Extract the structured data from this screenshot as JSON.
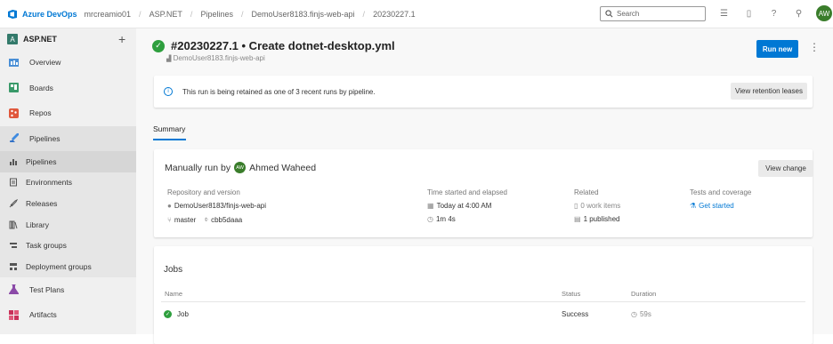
{
  "topbar": {
    "brand": "Azure DevOps",
    "breadcrumbs": [
      "mrcreamio01",
      "ASP.NET",
      "Pipelines",
      "DemoUser8183.finjs-web-api",
      "20230227.1"
    ],
    "search_placeholder": "Search",
    "avatar_initials": "AW"
  },
  "sidebar": {
    "project_initial": "A",
    "project_name": "ASP.NET",
    "main_items": [
      {
        "label": "Overview",
        "icon": "overview-icon"
      },
      {
        "label": "Boards",
        "icon": "boards-icon"
      },
      {
        "label": "Repos",
        "icon": "repos-icon"
      },
      {
        "label": "Pipelines",
        "icon": "pipelines-icon"
      }
    ],
    "sub_items": [
      {
        "label": "Pipelines",
        "icon": "pipelines-sub-icon"
      },
      {
        "label": "Environments",
        "icon": "environments-icon"
      },
      {
        "label": "Releases",
        "icon": "releases-icon"
      },
      {
        "label": "Library",
        "icon": "library-icon"
      },
      {
        "label": "Task groups",
        "icon": "task-groups-icon"
      },
      {
        "label": "Deployment groups",
        "icon": "deployment-groups-icon"
      }
    ],
    "bottom_items": [
      {
        "label": "Test Plans",
        "icon": "test-plans-icon"
      },
      {
        "label": "Artifacts",
        "icon": "artifacts-icon"
      }
    ]
  },
  "run": {
    "title": "#20230227.1 • Create dotnet-desktop.yml",
    "repo": "DemoUser8183.finjs-web-api",
    "run_new_label": "Run new"
  },
  "banner": {
    "text": "This run is being retained as one of 3 recent runs by pipeline.",
    "button": "View retention leases"
  },
  "tabs": {
    "summary": "Summary"
  },
  "summary": {
    "manually_run_by": "Manually run by",
    "user_initials": "AW",
    "user_name": "Ahmed Waheed",
    "view_change": "View change",
    "repo_header": "Repository and version",
    "repo_value": "DemoUser8183/finjs-web-api",
    "branch": "master",
    "commit": "cbb5daaa",
    "time_header": "Time started and elapsed",
    "time_started": "Today at 4:00 AM",
    "elapsed": "1m 4s",
    "related_header": "Related",
    "work_items": "0 work items",
    "published": "1 published",
    "tests_header": "Tests and coverage",
    "get_started": "Get started"
  },
  "jobs": {
    "title": "Jobs",
    "headers": {
      "name": "Name",
      "status": "Status",
      "duration": "Duration"
    },
    "rows": [
      {
        "name": "Job",
        "status": "Success",
        "duration": "59s"
      }
    ]
  },
  "colors": {
    "accent": "#0078d4",
    "success": "#2e9f3e",
    "avatar": "#3a7d2b"
  }
}
